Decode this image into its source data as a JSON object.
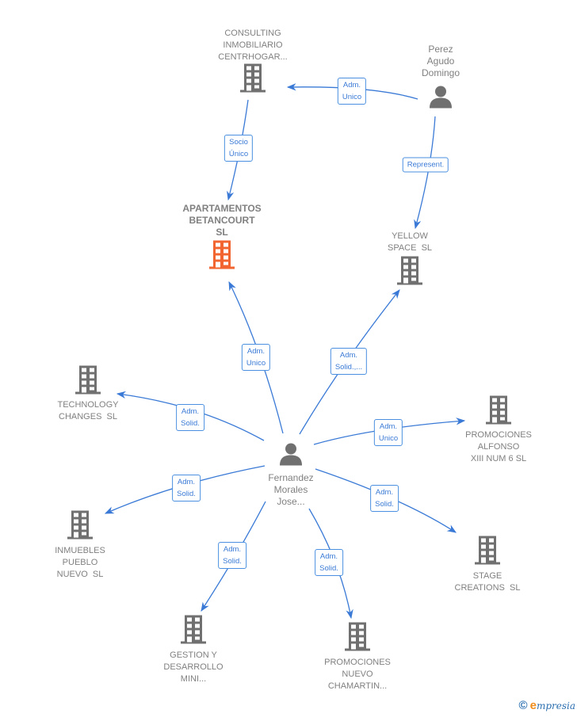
{
  "colors": {
    "edge": "#3a7ad6",
    "node_default": "#707070",
    "node_focus": "#f26430",
    "label_text": "#808080"
  },
  "nodes": [
    {
      "id": "consulting",
      "type": "company",
      "focus": false,
      "label_lines": [
        "CONSULTING",
        "INMOBILIARIO",
        "CENTRHOGAR..."
      ]
    },
    {
      "id": "perez",
      "type": "person",
      "focus": false,
      "label_lines": [
        "Perez",
        "Agudo",
        "Domingo"
      ]
    },
    {
      "id": "apartamentos",
      "type": "company",
      "focus": true,
      "label_lines": [
        "APARTAMENTOS",
        "BETANCOURT",
        "SL"
      ]
    },
    {
      "id": "yellow",
      "type": "company",
      "focus": false,
      "label_lines": [
        "YELLOW",
        "SPACE  SL"
      ]
    },
    {
      "id": "technology",
      "type": "company",
      "focus": false,
      "label_lines": [
        "TECHNOLOGY",
        "CHANGES  SL"
      ]
    },
    {
      "id": "fernandez",
      "type": "person",
      "focus": false,
      "label_lines": [
        "Fernandez",
        "Morales",
        "Jose..."
      ]
    },
    {
      "id": "promo_alfonso",
      "type": "company",
      "focus": false,
      "label_lines": [
        "PROMOCIONES",
        "ALFONSO",
        "XIII NUM 6 SL"
      ]
    },
    {
      "id": "inmuebles",
      "type": "company",
      "focus": false,
      "label_lines": [
        "INMUEBLES",
        "PUEBLO",
        "NUEVO  SL"
      ]
    },
    {
      "id": "stage",
      "type": "company",
      "focus": false,
      "label_lines": [
        "STAGE",
        "CREATIONS  SL"
      ]
    },
    {
      "id": "gestion",
      "type": "company",
      "focus": false,
      "label_lines": [
        "GESTION Y",
        "DESARROLLO",
        "MINI..."
      ]
    },
    {
      "id": "promo_chamartin",
      "type": "company",
      "focus": false,
      "label_lines": [
        "PROMOCIONES",
        "NUEVO",
        "CHAMARTIN..."
      ]
    }
  ],
  "edges": [
    {
      "from": "perez",
      "to": "consulting",
      "label_lines": [
        "Adm.",
        "Unico"
      ]
    },
    {
      "from": "consulting",
      "to": "apartamentos",
      "label_lines": [
        "Socio",
        "Único"
      ]
    },
    {
      "from": "perez",
      "to": "yellow",
      "label_lines": [
        "Represent."
      ]
    },
    {
      "from": "fernandez",
      "to": "apartamentos",
      "label_lines": [
        "Adm.",
        "Unico"
      ]
    },
    {
      "from": "fernandez",
      "to": "yellow",
      "label_lines": [
        "Adm.",
        "Solid.,..."
      ]
    },
    {
      "from": "fernandez",
      "to": "technology",
      "label_lines": [
        "Adm.",
        "Solid."
      ]
    },
    {
      "from": "fernandez",
      "to": "promo_alfonso",
      "label_lines": [
        "Adm.",
        "Unico"
      ]
    },
    {
      "from": "fernandez",
      "to": "inmuebles",
      "label_lines": [
        "Adm.",
        "Solid."
      ]
    },
    {
      "from": "fernandez",
      "to": "stage",
      "label_lines": [
        "Adm.",
        "Solid."
      ]
    },
    {
      "from": "fernandez",
      "to": "gestion",
      "label_lines": [
        "Adm.",
        "Solid."
      ]
    },
    {
      "from": "fernandez",
      "to": "promo_chamartin",
      "label_lines": [
        "Adm.",
        "Solid."
      ]
    }
  ],
  "footer": {
    "copyright_symbol": "©",
    "brand_initial": "e",
    "brand_rest": "mpresia"
  }
}
